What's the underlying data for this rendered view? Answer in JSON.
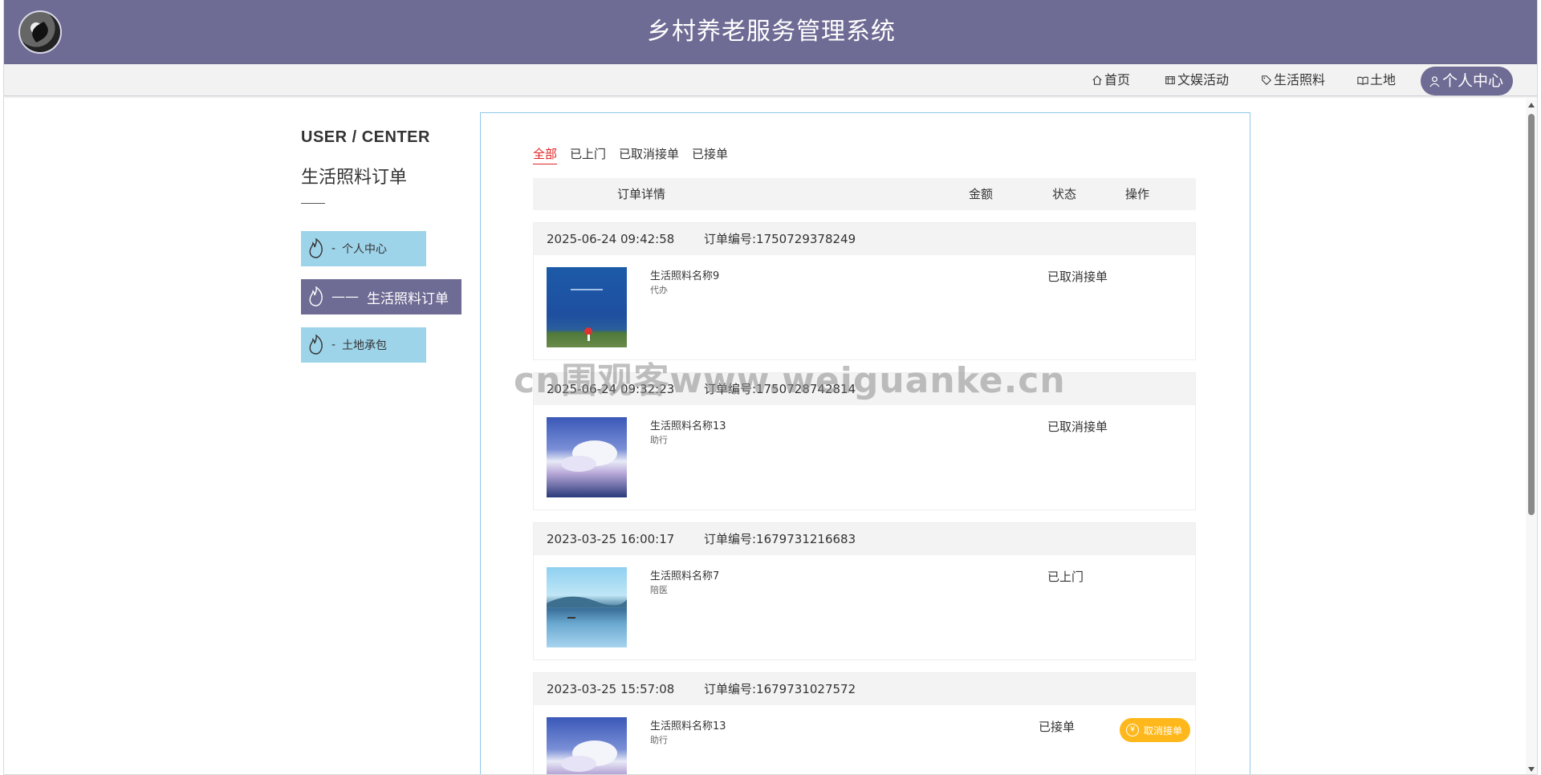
{
  "header": {
    "title": "乡村养老服务管理系统"
  },
  "nav": {
    "items": [
      {
        "label": "首页",
        "icon": "home-icon"
      },
      {
        "label": "文娱活动",
        "icon": "theater-icon"
      },
      {
        "label": "生活照料",
        "icon": "tag-icon"
      },
      {
        "label": "土地",
        "icon": "book-icon"
      }
    ],
    "user": {
      "label": "个人中心",
      "icon": "user-icon"
    }
  },
  "sidebar": {
    "title": "USER / CENTER",
    "subtitle": "生活照料订单",
    "items": [
      {
        "prefix": "-",
        "label": "个人中心"
      },
      {
        "prefix": "——",
        "label": "生活照料订单"
      },
      {
        "prefix": "-",
        "label": "土地承包"
      }
    ]
  },
  "tabs": [
    "全部",
    "已上门",
    "已取消接单",
    "已接单"
  ],
  "table": {
    "headers": {
      "detail": "订单详情",
      "amount": "金额",
      "status": "状态",
      "action": "操作"
    }
  },
  "orders": [
    {
      "time": "2025-06-24 09:42:58",
      "order_no": "订单编号:1750729378249",
      "name": "生活照料名称9",
      "category": "代办",
      "status": "已取消接单"
    },
    {
      "time": "2025-06-24 09:32:23",
      "order_no": "订单编号:1750728742814",
      "name": "生活照料名称13",
      "category": "助行",
      "status": "已取消接单"
    },
    {
      "time": "2023-03-25 16:00:17",
      "order_no": "订单编号:1679731216683",
      "name": "生活照料名称7",
      "category": "陪医",
      "status": "已上门"
    },
    {
      "time": "2023-03-25 15:57:08",
      "order_no": "订单编号:1679731027572",
      "name": "生活照料名称13",
      "category": "助行",
      "status": "已接单",
      "action": "取消接单",
      "action_icon": "yen-icon"
    }
  ],
  "watermark": "cn围观客www.weiguanke.cn",
  "colors": {
    "primary": "#6e6b94",
    "side_button": "#9ed4ea",
    "active_tab": "#e02222",
    "cancel_button": "#ffb81c"
  }
}
